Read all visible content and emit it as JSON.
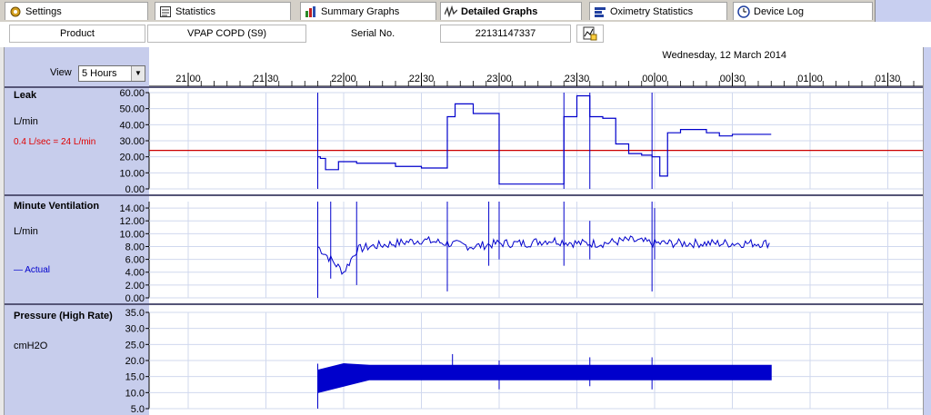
{
  "tabs": [
    {
      "label": "Settings",
      "icon": "settings-icon",
      "active": false
    },
    {
      "label": "Statistics",
      "icon": "statistics-icon",
      "active": false
    },
    {
      "label": "Summary Graphs",
      "icon": "bar-chart-icon",
      "active": false
    },
    {
      "label": "Detailed Graphs",
      "icon": "waveform-icon",
      "active": true
    },
    {
      "label": "Oximetry Statistics",
      "icon": "oximetry-icon",
      "active": false
    },
    {
      "label": "Device Log",
      "icon": "clock-icon",
      "active": false
    }
  ],
  "product_row": {
    "product_label": "Product",
    "product_value": "VPAP COPD (S9)",
    "serial_label": "Serial No.",
    "serial_value": "22131147337"
  },
  "view": {
    "label": "View",
    "value": "5 Hours"
  },
  "date": "Wednesday, 12 March 2014",
  "panels": {
    "leak": {
      "title": "Leak",
      "unit": "L/min",
      "note": "0.4 L/sec = 24 L/min"
    },
    "mv": {
      "title": "Minute Ventilation",
      "unit": "L/min",
      "legend": "Actual"
    },
    "pressure": {
      "title": "Pressure (High Rate)",
      "unit": "cmH2O"
    }
  },
  "colors": {
    "trace": "#0000cc",
    "threshold": "#cc0000",
    "panel": "#c7cdec"
  },
  "chart_data": [
    {
      "type": "line",
      "title": "Leak",
      "ylabel": "L/min",
      "ylim": [
        0,
        60
      ],
      "yticks": [
        "60.00",
        "50.00",
        "40.00",
        "30.00",
        "20.00",
        "10.00",
        "0.00"
      ],
      "xticks": [
        "21:00",
        "21:30",
        "22:00",
        "22:30",
        "23:00",
        "23:30",
        "00:00",
        "00:30",
        "01:00",
        "01:30"
      ],
      "threshold": 24,
      "x": [
        "21:50",
        "21:51",
        "21:53",
        "21:58",
        "22:05",
        "22:20",
        "22:30",
        "22:38",
        "22:40",
        "22:43",
        "22:50",
        "22:56",
        "23:00",
        "23:10",
        "23:20",
        "23:22",
        "23:25",
        "23:30",
        "23:35",
        "23:40",
        "23:45",
        "23:50",
        "23:55",
        "23:59",
        "00:02",
        "00:05",
        "00:10",
        "00:15",
        "00:20",
        "00:25",
        "00:30",
        "00:40",
        "00:45"
      ],
      "values": [
        20,
        19,
        12,
        17,
        16,
        14,
        13,
        13,
        45,
        53,
        47,
        47,
        3,
        3,
        3,
        3,
        45,
        58,
        45,
        44,
        28,
        22,
        21,
        20,
        8,
        35,
        37,
        37,
        35,
        33,
        34,
        34,
        34
      ]
    },
    {
      "type": "line",
      "title": "Minute Ventilation",
      "ylabel": "L/min",
      "ylim": [
        0,
        15
      ],
      "yticks": [
        "14.00",
        "12.00",
        "10.00",
        "8.00",
        "6.00",
        "4.00",
        "2.00",
        "0.00"
      ],
      "series": [
        {
          "name": "Actual",
          "x": [
            "21:50",
            "21:55",
            "22:00",
            "22:05",
            "22:10",
            "22:20",
            "22:30",
            "22:40",
            "22:50",
            "23:00",
            "23:10",
            "23:20",
            "23:30",
            "23:40",
            "23:50",
            "00:00",
            "00:10",
            "00:20",
            "00:30",
            "00:40",
            "00:45"
          ],
          "values": [
            8,
            6,
            4,
            7.5,
            8,
            8.5,
            9,
            8.5,
            8,
            8.5,
            8.5,
            9,
            8.5,
            8.5,
            9,
            8.5,
            8.5,
            8.5,
            8.5,
            8.5,
            8.5
          ]
        }
      ]
    },
    {
      "type": "area",
      "title": "Pressure (High Rate)",
      "ylabel": "cmH2O",
      "ylim": [
        5,
        35
      ],
      "yticks": [
        "35.0",
        "30.0",
        "25.0",
        "20.0",
        "15.0",
        "10.0",
        "5.0"
      ],
      "x": [
        "21:50",
        "22:00",
        "22:10",
        "22:30",
        "23:00",
        "23:30",
        "00:00",
        "00:30",
        "00:45"
      ],
      "low": [
        10,
        12,
        14,
        14,
        14,
        14,
        14,
        14,
        14
      ],
      "high": [
        17,
        19,
        18.5,
        18.5,
        18.5,
        18.5,
        18.5,
        18.5,
        18.5
      ]
    }
  ]
}
